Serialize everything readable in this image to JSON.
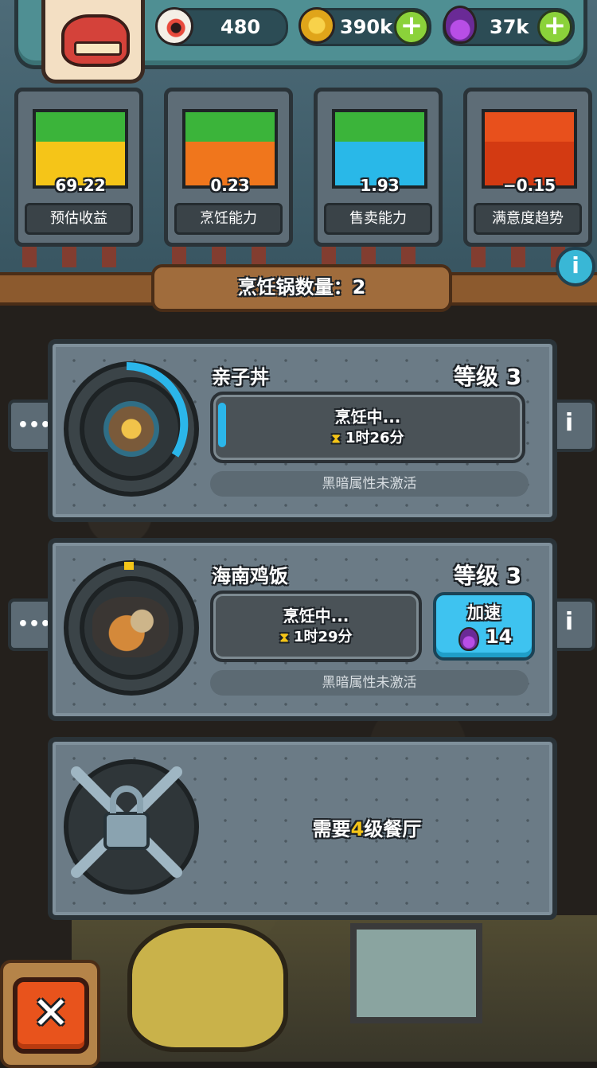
{
  "header": {
    "eyeballs": "480",
    "coins": "390k",
    "potions": "37k",
    "icons": {
      "eyeball": "eyeball-icon",
      "coin": "coin-icon",
      "potion": "potion-icon",
      "add": "plus-icon"
    }
  },
  "gauges": [
    {
      "label": "预估收益",
      "value": "69.22",
      "colors": [
        "#3bb43a",
        "#f5c518"
      ]
    },
    {
      "label": "烹饪能力",
      "value": "0.23",
      "colors": [
        "#3bb43a",
        "#f0761c"
      ]
    },
    {
      "label": "售卖能力",
      "value": "1.93",
      "colors": [
        "#3bb43a",
        "#29b8e8"
      ]
    },
    {
      "label": "满意度趋势",
      "value": "−0.15",
      "colors": [
        "#e8501c",
        "#d33a12"
      ]
    }
  ],
  "banner": {
    "text": "烹饪锅数量：2"
  },
  "pots": [
    {
      "name": "亲子丼",
      "level": "等级 3",
      "status": "烹饪中...",
      "time": "1时26分",
      "dark_attr": "黑暗属性未激活"
    },
    {
      "name": "海南鸡饭",
      "level": "等级 3",
      "status": "烹饪中...",
      "time": "1时29分",
      "dark_attr": "黑暗属性未激活",
      "speedup": {
        "label": "加速",
        "cost": "14"
      }
    }
  ],
  "locked": {
    "prefix": "需要",
    "level": "4",
    "suffix": "级餐厅"
  },
  "buttons": {
    "more": "•••",
    "info": "i",
    "close": "✕",
    "hourglass": "⧗"
  }
}
